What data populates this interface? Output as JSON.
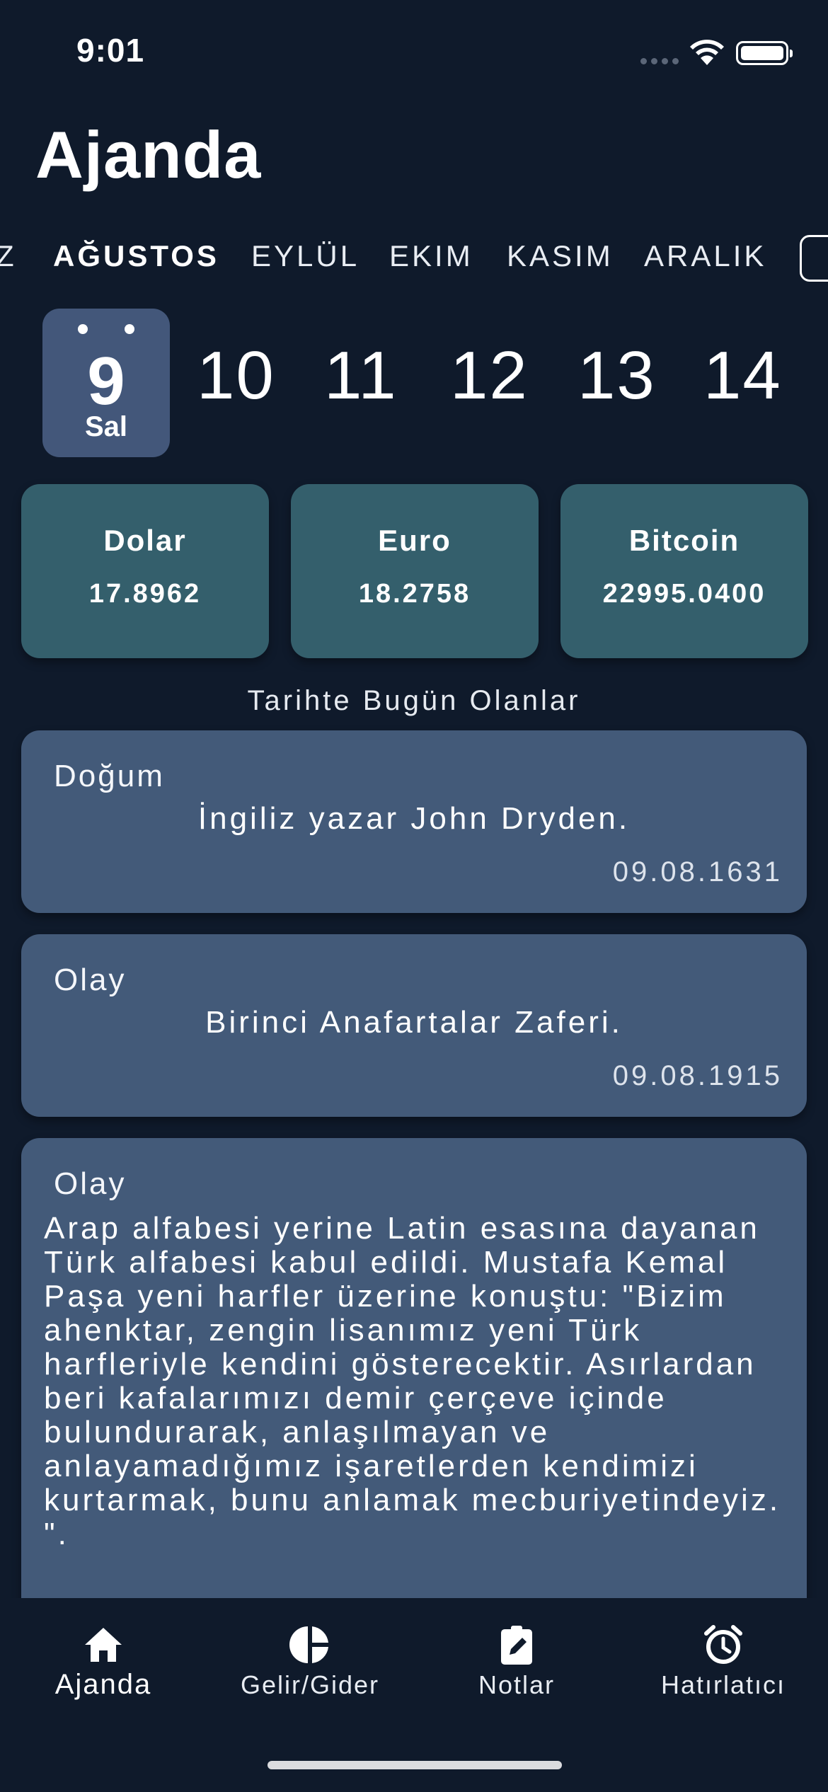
{
  "status_bar": {
    "time": "9:01"
  },
  "header": {
    "title": "Ajanda"
  },
  "months": [
    {
      "label": "Z",
      "active": false
    },
    {
      "label": "AĞUSTOS",
      "active": true
    },
    {
      "label": "EYLÜL",
      "active": false
    },
    {
      "label": "EKIM",
      "active": false
    },
    {
      "label": "KASIM",
      "active": false
    },
    {
      "label": "ARALIK",
      "active": false
    }
  ],
  "days": {
    "selected": {
      "number": "9",
      "weekday": "Sal"
    },
    "others": [
      "10",
      "11",
      "12",
      "13",
      "14"
    ]
  },
  "currencies": [
    {
      "name": "Dolar",
      "value": "17.8962"
    },
    {
      "name": "Euro",
      "value": "18.2758"
    },
    {
      "name": "Bitcoin",
      "value": "22995.0400"
    }
  ],
  "history": {
    "title": "Tarihte Bugün Olanlar",
    "events": [
      {
        "type": "Doğum",
        "text": "İngiliz yazar John Dryden.",
        "date": "09.08.1631"
      },
      {
        "type": "Olay",
        "text": "Birinci Anafartalar Zaferi.",
        "date": "09.08.1915"
      },
      {
        "type": "Olay",
        "text": "Arap alfabesi yerine Latin esasına dayanan Türk alfabesi kabul edildi. Mustafa Kemal Paşa yeni harfler üzerine konuştu: \"Bizim ahenktar, zengin lisanımız yeni Türk harfleriyle kendini gösterecektir. Asırlardan beri kafalarımızı demir çerçeve içinde bulundurarak, anlaşılmayan ve anlayamadığımız işaretlerden kendimizi kurtarmak, bunu anlamak mecburiyetindeyiz. \"."
      }
    ]
  },
  "tab_bar": {
    "tabs": [
      {
        "label": "Ajanda",
        "icon": "home-icon",
        "active": true
      },
      {
        "label": "Gelir/Gider",
        "icon": "pie-chart-icon",
        "active": false
      },
      {
        "label": "Notlar",
        "icon": "clipboard-edit-icon",
        "active": false
      },
      {
        "label": "Hatırlatıcı",
        "icon": "alarm-clock-icon",
        "active": false
      }
    ]
  },
  "colors": {
    "background": "#0f1a2b",
    "selected_day": "#43577a",
    "currency_card": "#345f6c",
    "event_card": "#435a79"
  }
}
